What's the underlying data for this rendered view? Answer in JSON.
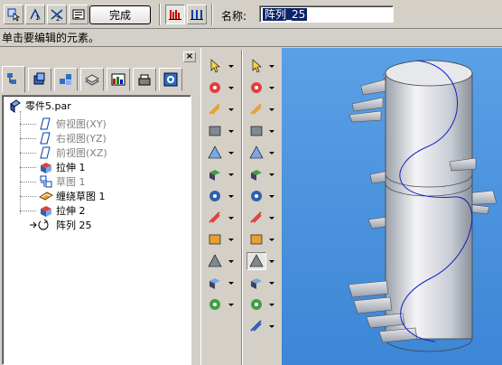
{
  "ribbon": {
    "finish_label": "完成",
    "name_label": "名称:",
    "name_value": "阵列_25",
    "icons": [
      "select-step-icon",
      "rectangle-step-icon",
      "count-step-icon",
      "options-icon",
      "bar-chart-icon",
      "spacing-icon"
    ]
  },
  "prompt": {
    "text": "单击要编辑的元素。"
  },
  "edgebar": {
    "close_label": "×",
    "tabs": [
      "feature-pathfinder-tab",
      "layers-tab",
      "family-tab",
      "sensors-tab",
      "library-tab",
      "features-tab",
      "properties-tab"
    ],
    "tree": [
      {
        "label": "零件5.par",
        "icon": "part-icon",
        "dim": false
      },
      {
        "label": "俯视图(XY)",
        "icon": "plane-icon",
        "dim": true
      },
      {
        "label": "右视图(YZ)",
        "icon": "plane-icon",
        "dim": true
      },
      {
        "label": "前视图(XZ)",
        "icon": "plane-icon",
        "dim": true
      },
      {
        "label": "拉伸 1",
        "icon": "extrude-icon",
        "dim": false
      },
      {
        "label": "草图 1",
        "icon": "sketch-icon",
        "dim": true
      },
      {
        "label": "缠绕草图 1",
        "icon": "wrap-sketch-icon",
        "dim": false
      },
      {
        "label": "拉伸 2",
        "icon": "extrude-icon",
        "dim": false
      },
      {
        "label": "阵列 25",
        "icon": "pattern-icon",
        "dim": false
      }
    ]
  },
  "commands": {
    "left_column": [
      "select-icon",
      "extrude-icon",
      "revolve-icon",
      "cutout-icon",
      "hole-icon",
      "round-icon",
      "thin-wall-icon",
      "helix-icon",
      "thread-icon",
      "rib-icon",
      "lip-icon",
      "web-network-icon"
    ],
    "right_column": [
      "select-arrow-icon",
      "smart-select-icon",
      "draft-icon",
      "chamfer-icon",
      "mirror-icon",
      "pattern-rect-icon",
      "pattern-circle-icon",
      "plane-coincident-icon",
      "curve-icon",
      "pattern-along-curve-icon",
      "add-body-icon",
      "boolean-icon",
      "measure-icon"
    ]
  }
}
